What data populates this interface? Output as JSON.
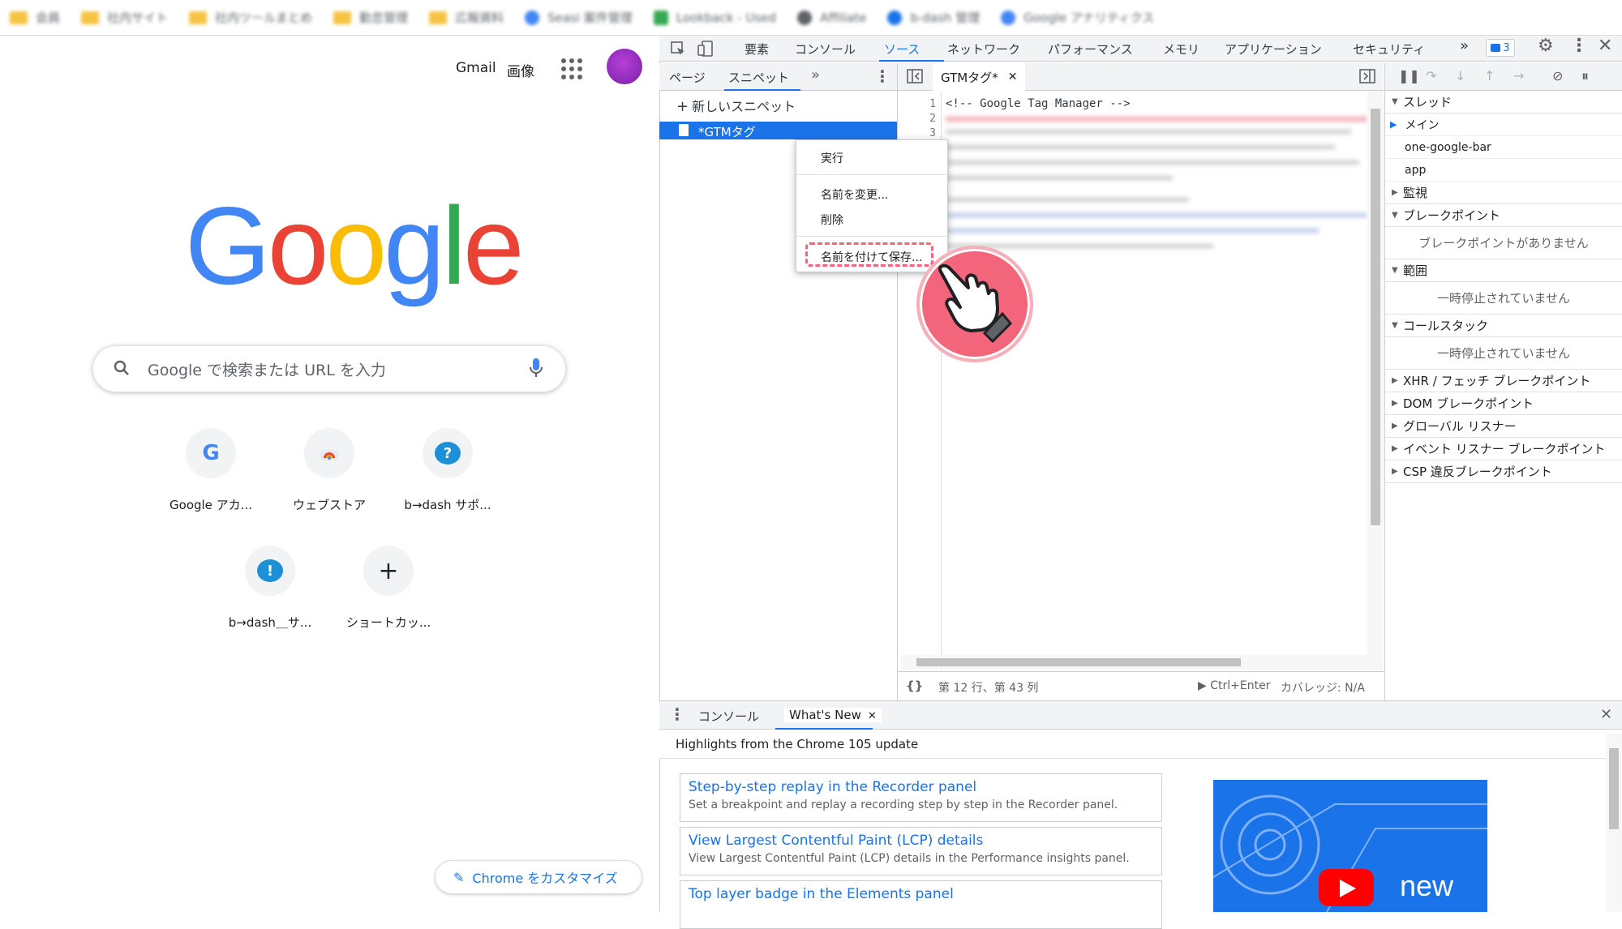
{
  "bookmarks": [
    "会員",
    "社内サイト",
    "社内ツールまとめ",
    "勤怠管理",
    "広報資料",
    "Seasi 案件管理",
    "Lookback - Used",
    "Affiliate",
    "b-dash 管理",
    "Google アナリティクス"
  ],
  "ntp": {
    "gmail": "Gmail",
    "images": "画像",
    "logo": [
      "G",
      "o",
      "o",
      "g",
      "l",
      "e"
    ],
    "logo_colors": [
      "#4285f4",
      "#ea4335",
      "#fbbc05",
      "#4285f4",
      "#34a853",
      "#ea4335"
    ],
    "search_placeholder": "Google で検索または URL を入力",
    "shortcuts": [
      {
        "label": "Google アカ...",
        "icon": "google-icon"
      },
      {
        "label": "ウェブストア",
        "icon": "webstore-icon"
      },
      {
        "label": "b→dash サポ...",
        "icon": "bdash-icon"
      },
      {
        "label": "b→dash＿サ...",
        "icon": "bdash-icon"
      },
      {
        "label": "ショートカッ...",
        "icon": "plus-icon"
      }
    ],
    "customize": "Chrome をカスタマイズ"
  },
  "devtools": {
    "tabs": [
      "要素",
      "コンソール",
      "ソース",
      "ネットワーク",
      "パフォーマンス",
      "メモリ",
      "アプリケーション",
      "セキュリティ"
    ],
    "active_tab": "ソース",
    "more": "»",
    "issues_count": "3",
    "nav_tabs": [
      "ページ",
      "スニペット"
    ],
    "new_snippet": "新しいスニペット",
    "snippet_file": "*GTMタグ",
    "editor_tab": "GTMタグ*",
    "line_numbers": [
      "1",
      "2",
      "3"
    ],
    "code_line1": "<!-- Google Tag Manager -->",
    "cursor_pos": "第 12 行、第 43 列",
    "run_shortcut": "Ctrl+Enter",
    "coverage": "カバレッジ: N/A",
    "context_menu": {
      "run": "実行",
      "rename": "名前を変更...",
      "delete": "削除",
      "save_as": "名前を付けて保存..."
    },
    "debugger": {
      "threads": "スレッド",
      "main": "メイン",
      "one_google_bar": "one-google-bar",
      "app": "app",
      "watch": "監視",
      "breakpoints": "ブレークポイント",
      "no_breakpoints": "ブレークポイントがありません",
      "scope": "範囲",
      "not_paused": "一時停止されていません",
      "call_stack": "コールスタック",
      "not_paused2": "一時停止されていません",
      "xhr": "XHR / フェッチ ブレークポイント",
      "dom": "DOM ブレークポイント",
      "global": "グローバル リスナー",
      "event": "イベント リスナー ブレークポイント",
      "csp": "CSP 違反ブレークポイント"
    },
    "drawer": {
      "tabs": [
        "コンソール",
        "What's New"
      ],
      "highlights": "Highlights from the Chrome 105 update",
      "cards": [
        {
          "title": "Step-by-step replay in the Recorder panel",
          "desc": "Set a breakpoint and replay a recording step by step in the Recorder panel."
        },
        {
          "title": "View Largest Contentful Paint (LCP) details",
          "desc": "View Largest Contentful Paint (LCP) details in the Performance insights panel."
        },
        {
          "title": "Top layer badge in the Elements panel",
          "desc": ""
        }
      ],
      "video_label": "new"
    }
  },
  "colors": {
    "accent": "#1a73e8",
    "highlight": "#f2657a"
  }
}
